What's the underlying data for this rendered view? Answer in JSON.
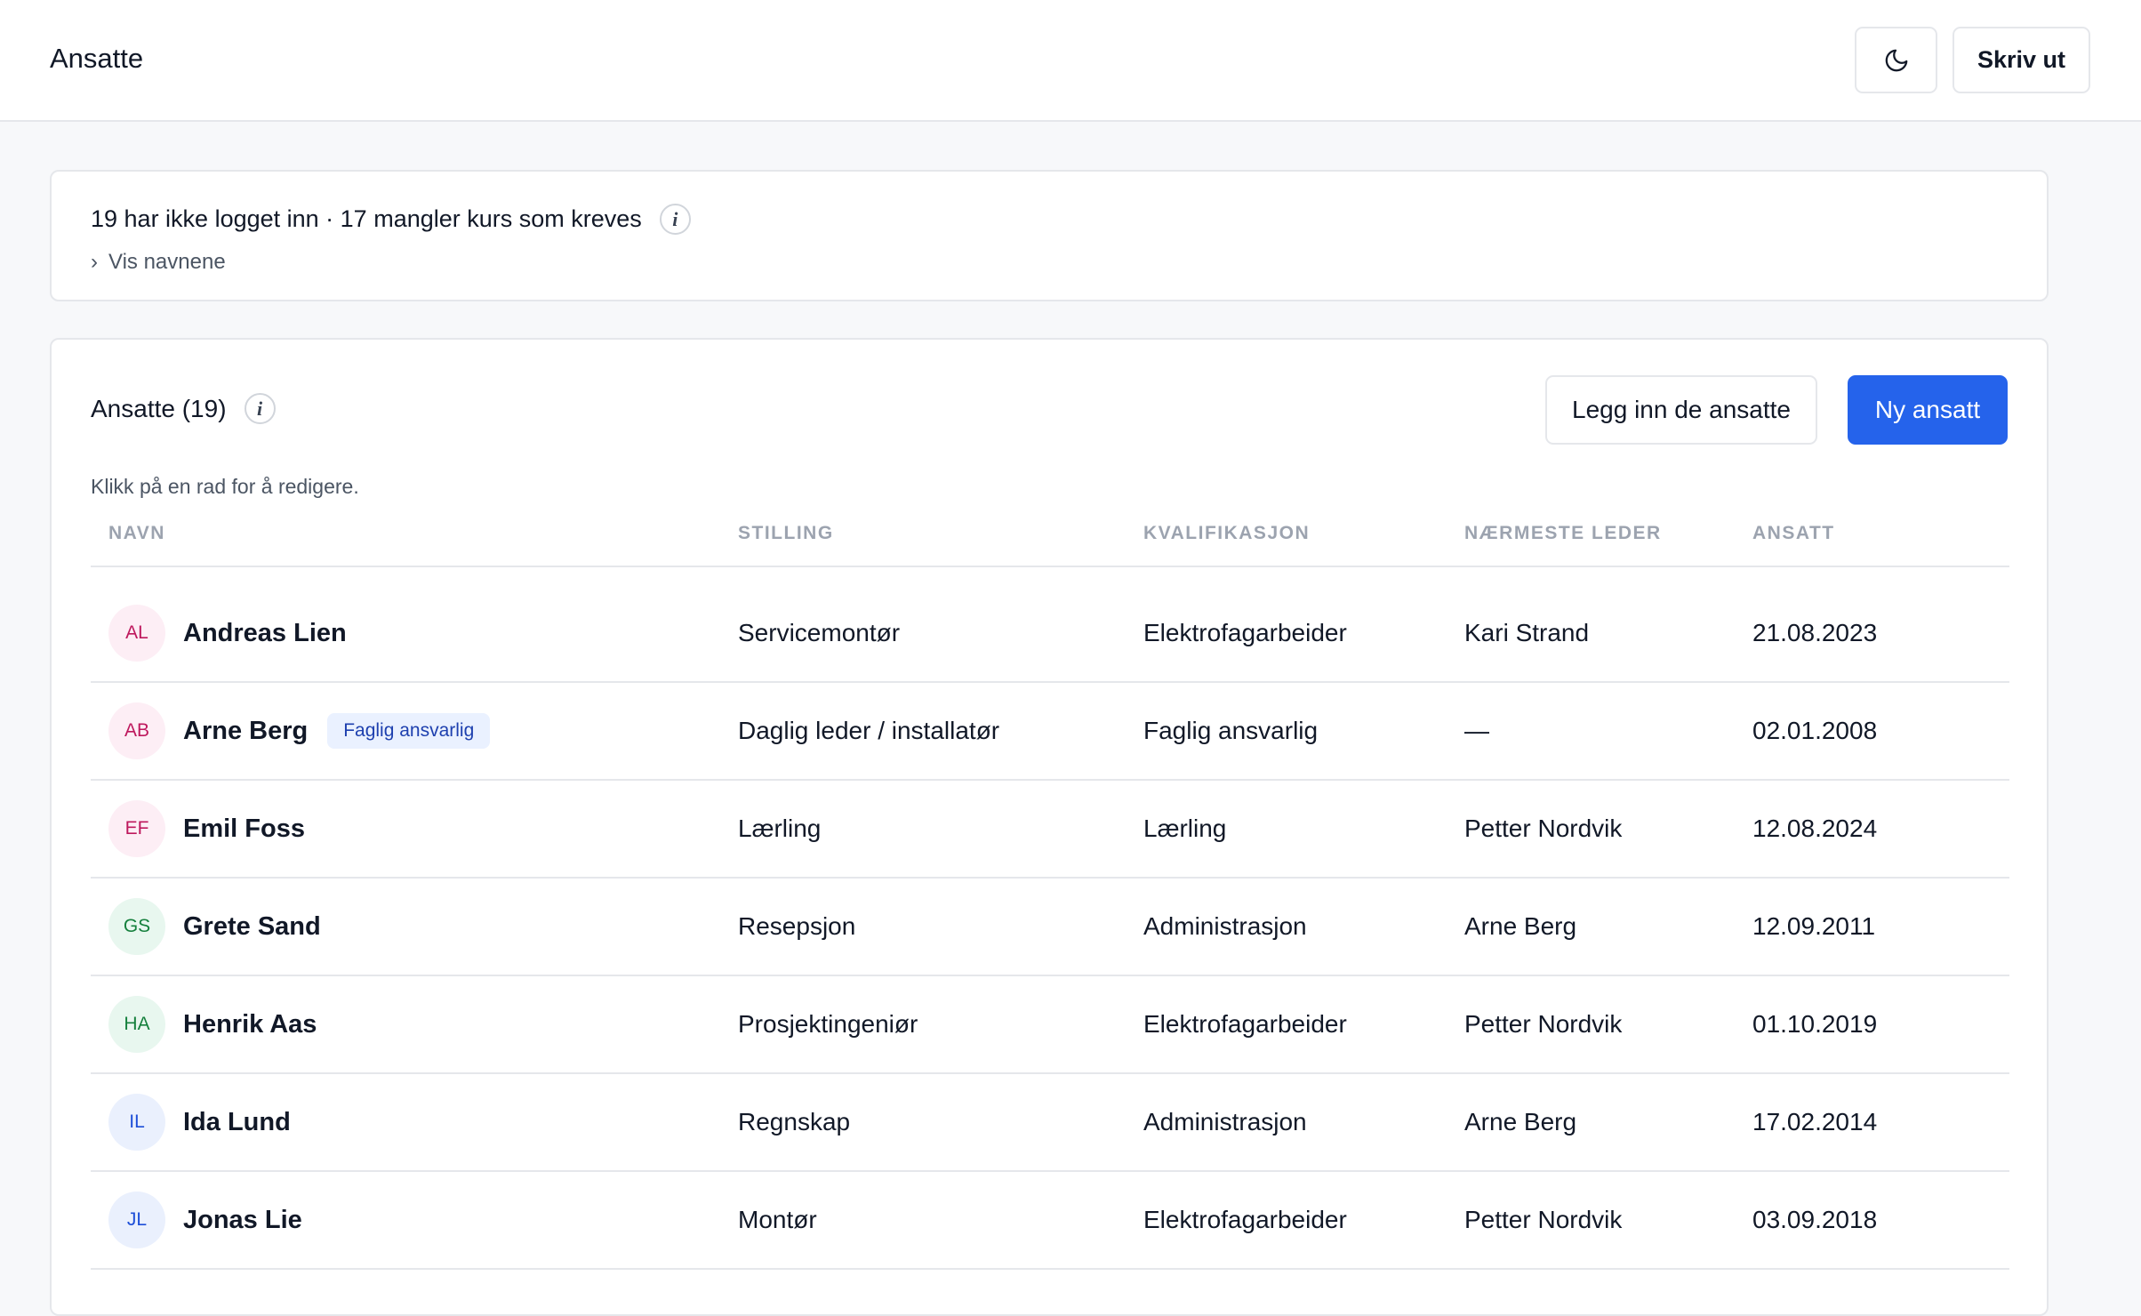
{
  "header": {
    "title": "Ansatte",
    "print_label": "Skriv ut",
    "theme_icon": "moon-icon"
  },
  "summary": {
    "text": "19 har ikke logget inn · 17 mangler kurs som kreves",
    "info_icon": "info-icon",
    "toggle_label": "Vis navnene",
    "toggle_icon": "chevron-right-icon"
  },
  "employees": {
    "title": "Ansatte (19)",
    "bulk_add_label": "Legg inn de ansatte",
    "new_label": "Ny ansatt",
    "hint": "Klikk på en rad for å redigere.",
    "columns": [
      "NAVN",
      "STILLING",
      "KVALIFIKASJON",
      "NÆRMESTE LEDER",
      "ANSATT"
    ],
    "rows": [
      {
        "initials": "AL",
        "name": "Andreas Lien",
        "badge": "",
        "stilling": "Servicemontør",
        "kvalifikasjon": "Elektrofagarbeider",
        "leder": "Kari Strand",
        "ansatt": "21.08.2023",
        "avatar_bg": "#fdeef5",
        "avatar_fg": "#be185d"
      },
      {
        "initials": "AB",
        "name": "Arne Berg",
        "badge": "Faglig ansvarlig",
        "stilling": "Daglig leder / installatør",
        "kvalifikasjon": "Faglig ansvarlig",
        "leder": "—",
        "ansatt": "02.01.2008",
        "avatar_bg": "#fdeef5",
        "avatar_fg": "#be185d"
      },
      {
        "initials": "EF",
        "name": "Emil Foss",
        "badge": "",
        "stilling": "Lærling",
        "kvalifikasjon": "Lærling",
        "leder": "Petter Nordvik",
        "ansatt": "12.08.2024",
        "avatar_bg": "#fdeef5",
        "avatar_fg": "#be185d"
      },
      {
        "initials": "GS",
        "name": "Grete Sand",
        "badge": "",
        "stilling": "Resepsjon",
        "kvalifikasjon": "Administrasjon",
        "leder": "Arne Berg",
        "ansatt": "12.09.2011",
        "avatar_bg": "#e8f7ef",
        "avatar_fg": "#15803d"
      },
      {
        "initials": "HA",
        "name": "Henrik Aas",
        "badge": "",
        "stilling": "Prosjektingeniør",
        "kvalifikasjon": "Elektrofagarbeider",
        "leder": "Petter Nordvik",
        "ansatt": "01.10.2019",
        "avatar_bg": "#e8f7ef",
        "avatar_fg": "#15803d"
      },
      {
        "initials": "IL",
        "name": "Ida Lund",
        "badge": "",
        "stilling": "Regnskap",
        "kvalifikasjon": "Administrasjon",
        "leder": "Arne Berg",
        "ansatt": "17.02.2014",
        "avatar_bg": "#eaf0fd",
        "avatar_fg": "#1d4ed8"
      },
      {
        "initials": "JL",
        "name": "Jonas Lie",
        "badge": "",
        "stilling": "Montør",
        "kvalifikasjon": "Elektrofagarbeider",
        "leder": "Petter Nordvik",
        "ansatt": "03.09.2018",
        "avatar_bg": "#eaf0fd",
        "avatar_fg": "#1d4ed8"
      }
    ]
  },
  "colors": {
    "primary": "#2563eb",
    "border": "#e5e7eb",
    "background": "#f7f8fa",
    "badge_bg": "#eaf1ff",
    "badge_fg": "#1e40af"
  }
}
